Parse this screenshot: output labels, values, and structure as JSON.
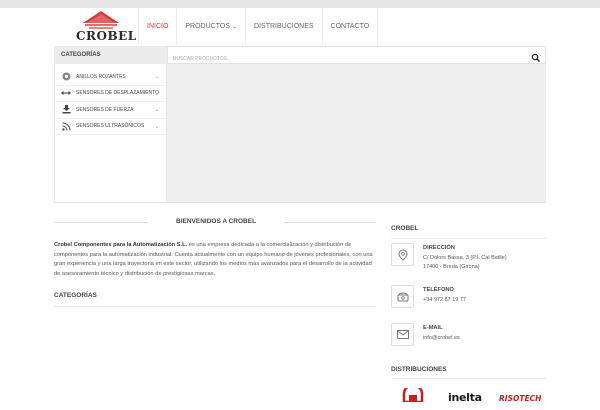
{
  "brand": {
    "name": "CROBEL",
    "accent": "#d63b3b"
  },
  "nav": {
    "items": [
      {
        "label": "INICIO",
        "active": true
      },
      {
        "label": "PRODUCTOS",
        "caret": "chevron-down-icon"
      },
      {
        "label": "DISTRIBUCIONES"
      },
      {
        "label": "CONTACTO"
      }
    ]
  },
  "categories_bar": {
    "title": "CATEGORÍAS"
  },
  "search": {
    "placeholder": "Buscar productos",
    "icon": "search-icon"
  },
  "category_list": [
    {
      "label": "ANILLOS ROZANTES",
      "icon": "slip-ring-icon"
    },
    {
      "label": "SENSORES DE DESPLAZAMIENTO",
      "icon": "double-arrow-icon"
    },
    {
      "label": "SENSORES DE FUERZA",
      "icon": "download-icon"
    },
    {
      "label": "SENSORES ULTRASÓNICOS",
      "icon": "rss-icon"
    }
  ],
  "welcome": {
    "title": "BIENVENIDOS A CROBEL",
    "company": "Crobel Componentes para la Automatización S.L.",
    "text": " es una empresa dedicada a la comercialización y distribución de componentes para la automatización industrial. Cuenta actualmente con un equipo humano de jóvenes profesionales, con una gran experiencia y una larga trayectoria en este sector, utilizando los medios más avanzados para el desarrollo de la actividad de asesoramiento técnico y distribución de prestigiosas marcas."
  },
  "categories_section": {
    "title": "CATEGORÍAS"
  },
  "sidebar": {
    "title": "CROBEL",
    "address": {
      "label": "DIRECCIÓN",
      "line1": "C/ Dòlors Bassa, 3 (P.I. Cal Batlle)",
      "line2": "17400 - Breda (Girona)",
      "icon": "map-pin-icon"
    },
    "phone": {
      "label": "TELÉFONO",
      "value": "+34 972 87 19 77",
      "icon": "phone-icon"
    },
    "email": {
      "label": "E-MAIL",
      "value": "info@crobel.es",
      "icon": "envelope-icon"
    },
    "distributions_title": "DISTRIBUCIONES",
    "distributions": [
      {
        "name": "inelta",
        "color": "#1a1a1a"
      },
      {
        "name": "RISOTECH",
        "color": "#c82020"
      }
    ]
  }
}
